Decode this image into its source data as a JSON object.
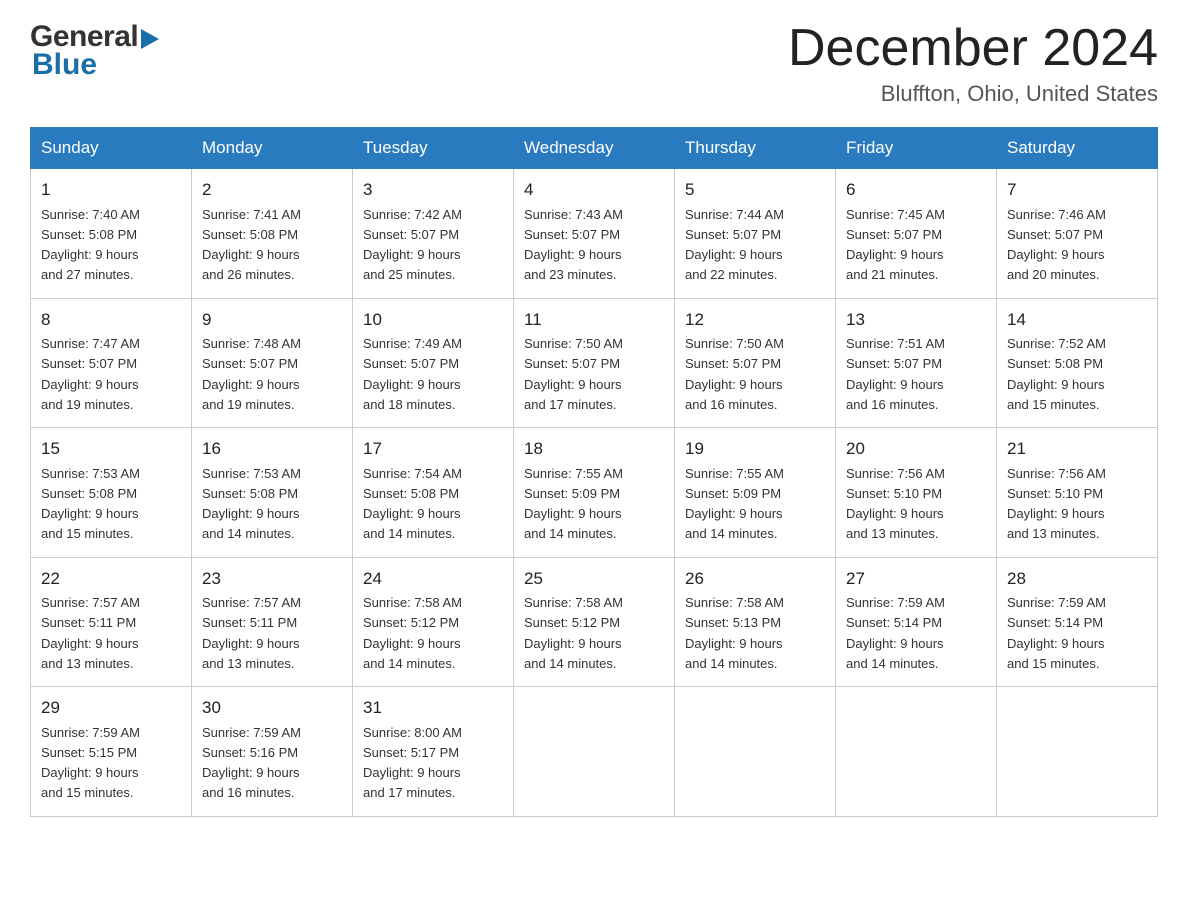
{
  "logo": {
    "general": "General",
    "blue": "Blue"
  },
  "title": "December 2024",
  "subtitle": "Bluffton, Ohio, United States",
  "days_of_week": [
    "Sunday",
    "Monday",
    "Tuesday",
    "Wednesday",
    "Thursday",
    "Friday",
    "Saturday"
  ],
  "weeks": [
    [
      {
        "day": "1",
        "sunrise": "7:40 AM",
        "sunset": "5:08 PM",
        "daylight": "9 hours and 27 minutes."
      },
      {
        "day": "2",
        "sunrise": "7:41 AM",
        "sunset": "5:08 PM",
        "daylight": "9 hours and 26 minutes."
      },
      {
        "day": "3",
        "sunrise": "7:42 AM",
        "sunset": "5:07 PM",
        "daylight": "9 hours and 25 minutes."
      },
      {
        "day": "4",
        "sunrise": "7:43 AM",
        "sunset": "5:07 PM",
        "daylight": "9 hours and 23 minutes."
      },
      {
        "day": "5",
        "sunrise": "7:44 AM",
        "sunset": "5:07 PM",
        "daylight": "9 hours and 22 minutes."
      },
      {
        "day": "6",
        "sunrise": "7:45 AM",
        "sunset": "5:07 PM",
        "daylight": "9 hours and 21 minutes."
      },
      {
        "day": "7",
        "sunrise": "7:46 AM",
        "sunset": "5:07 PM",
        "daylight": "9 hours and 20 minutes."
      }
    ],
    [
      {
        "day": "8",
        "sunrise": "7:47 AM",
        "sunset": "5:07 PM",
        "daylight": "9 hours and 19 minutes."
      },
      {
        "day": "9",
        "sunrise": "7:48 AM",
        "sunset": "5:07 PM",
        "daylight": "9 hours and 19 minutes."
      },
      {
        "day": "10",
        "sunrise": "7:49 AM",
        "sunset": "5:07 PM",
        "daylight": "9 hours and 18 minutes."
      },
      {
        "day": "11",
        "sunrise": "7:50 AM",
        "sunset": "5:07 PM",
        "daylight": "9 hours and 17 minutes."
      },
      {
        "day": "12",
        "sunrise": "7:50 AM",
        "sunset": "5:07 PM",
        "daylight": "9 hours and 16 minutes."
      },
      {
        "day": "13",
        "sunrise": "7:51 AM",
        "sunset": "5:07 PM",
        "daylight": "9 hours and 16 minutes."
      },
      {
        "day": "14",
        "sunrise": "7:52 AM",
        "sunset": "5:08 PM",
        "daylight": "9 hours and 15 minutes."
      }
    ],
    [
      {
        "day": "15",
        "sunrise": "7:53 AM",
        "sunset": "5:08 PM",
        "daylight": "9 hours and 15 minutes."
      },
      {
        "day": "16",
        "sunrise": "7:53 AM",
        "sunset": "5:08 PM",
        "daylight": "9 hours and 14 minutes."
      },
      {
        "day": "17",
        "sunrise": "7:54 AM",
        "sunset": "5:08 PM",
        "daylight": "9 hours and 14 minutes."
      },
      {
        "day": "18",
        "sunrise": "7:55 AM",
        "sunset": "5:09 PM",
        "daylight": "9 hours and 14 minutes."
      },
      {
        "day": "19",
        "sunrise": "7:55 AM",
        "sunset": "5:09 PM",
        "daylight": "9 hours and 14 minutes."
      },
      {
        "day": "20",
        "sunrise": "7:56 AM",
        "sunset": "5:10 PM",
        "daylight": "9 hours and 13 minutes."
      },
      {
        "day": "21",
        "sunrise": "7:56 AM",
        "sunset": "5:10 PM",
        "daylight": "9 hours and 13 minutes."
      }
    ],
    [
      {
        "day": "22",
        "sunrise": "7:57 AM",
        "sunset": "5:11 PM",
        "daylight": "9 hours and 13 minutes."
      },
      {
        "day": "23",
        "sunrise": "7:57 AM",
        "sunset": "5:11 PM",
        "daylight": "9 hours and 13 minutes."
      },
      {
        "day": "24",
        "sunrise": "7:58 AM",
        "sunset": "5:12 PM",
        "daylight": "9 hours and 14 minutes."
      },
      {
        "day": "25",
        "sunrise": "7:58 AM",
        "sunset": "5:12 PM",
        "daylight": "9 hours and 14 minutes."
      },
      {
        "day": "26",
        "sunrise": "7:58 AM",
        "sunset": "5:13 PM",
        "daylight": "9 hours and 14 minutes."
      },
      {
        "day": "27",
        "sunrise": "7:59 AM",
        "sunset": "5:14 PM",
        "daylight": "9 hours and 14 minutes."
      },
      {
        "day": "28",
        "sunrise": "7:59 AM",
        "sunset": "5:14 PM",
        "daylight": "9 hours and 15 minutes."
      }
    ],
    [
      {
        "day": "29",
        "sunrise": "7:59 AM",
        "sunset": "5:15 PM",
        "daylight": "9 hours and 15 minutes."
      },
      {
        "day": "30",
        "sunrise": "7:59 AM",
        "sunset": "5:16 PM",
        "daylight": "9 hours and 16 minutes."
      },
      {
        "day": "31",
        "sunrise": "8:00 AM",
        "sunset": "5:17 PM",
        "daylight": "9 hours and 17 minutes."
      },
      null,
      null,
      null,
      null
    ]
  ],
  "labels": {
    "sunrise": "Sunrise:",
    "sunset": "Sunset:",
    "daylight": "Daylight:"
  }
}
